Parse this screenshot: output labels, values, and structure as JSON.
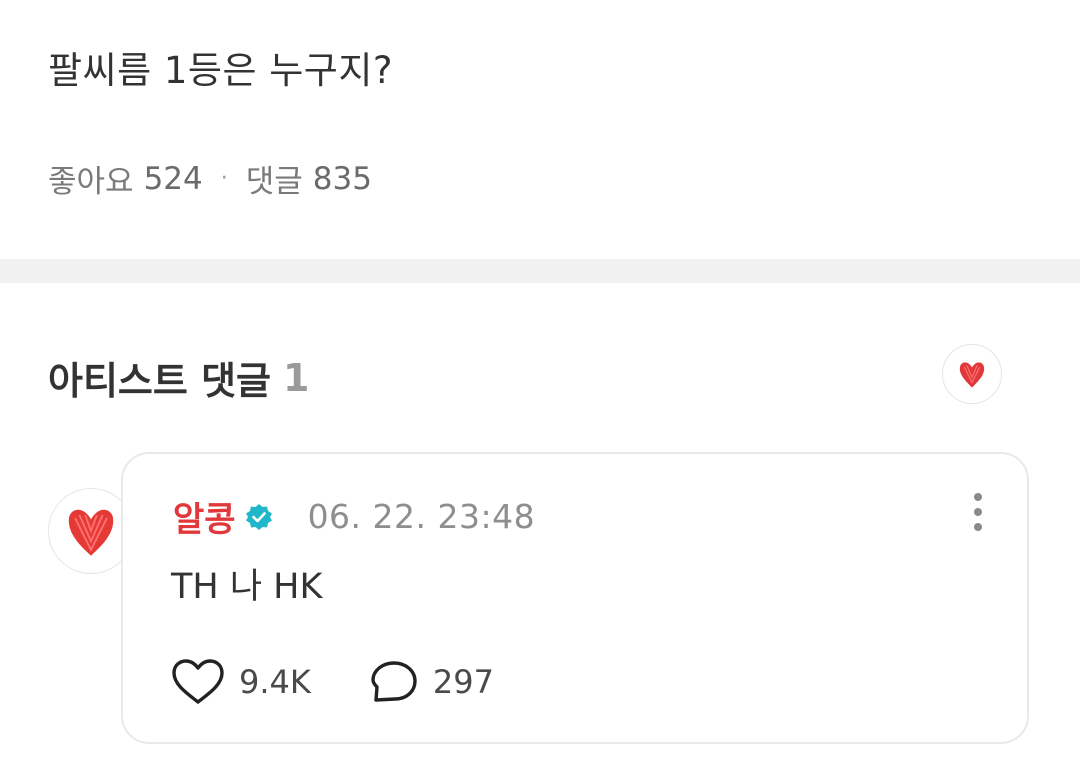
{
  "post": {
    "title": "팔씨름 1등은 누구지?",
    "likes_label": "좋아요",
    "likes_count": "524",
    "separator": "·",
    "comments_label": "댓글",
    "comments_count": "835"
  },
  "artist_section": {
    "title": "아티스트 댓글",
    "count": "1",
    "badge_icon": "artist-heart-icon"
  },
  "comment": {
    "author": "알콩",
    "author_color": "#e0383b",
    "verified_icon": "verified-check-icon",
    "timestamp": "06. 22. 23:48",
    "body": "TH 나 HK",
    "likes": "9.4K",
    "replies": "297",
    "avatar_icon": "red-heart-avatar",
    "more_icon": "more-vertical-icon",
    "like_icon": "heart-outline-icon",
    "reply_icon": "speech-bubble-icon"
  },
  "colors": {
    "accent_red": "#e0383b",
    "verified_teal": "#1fb7c9",
    "divider": "#f1f1f1"
  }
}
